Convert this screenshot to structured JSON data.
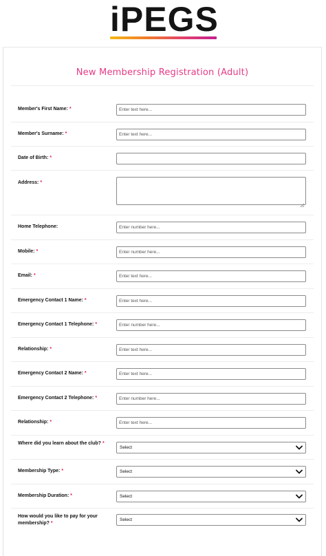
{
  "logo": {
    "text": "iPEGS"
  },
  "form": {
    "title": "New Membership Registration (Adult)",
    "required_mark": "*",
    "fields": [
      {
        "label": "Member's First Name:",
        "required": true,
        "type": "text",
        "placeholder": "Enter text here..."
      },
      {
        "label": "Member's Surname:",
        "required": true,
        "type": "text",
        "placeholder": "Enter text here..."
      },
      {
        "label": "Date of Birth:",
        "required": true,
        "type": "text",
        "placeholder": ""
      },
      {
        "label": "Address:",
        "required": true,
        "type": "textarea",
        "placeholder": ""
      },
      {
        "label": "Home Telephone:",
        "required": false,
        "type": "text",
        "placeholder": "Enter number here..."
      },
      {
        "label": "Mobile:",
        "required": true,
        "type": "text",
        "placeholder": "Enter number here..."
      },
      {
        "label": "Email:",
        "required": true,
        "type": "text",
        "placeholder": "Enter text here..."
      },
      {
        "label": "Emergency Contact 1 Name:",
        "required": true,
        "type": "text",
        "placeholder": "Enter text here..."
      },
      {
        "label": "Emergency Contact 1 Telephone:",
        "required": true,
        "type": "text",
        "placeholder": "Enter number here..."
      },
      {
        "label": "Relationship:",
        "required": true,
        "type": "text",
        "placeholder": "Enter text here..."
      },
      {
        "label": "Emergency Contact 2 Name:",
        "required": true,
        "type": "text",
        "placeholder": "Enter text here..."
      },
      {
        "label": "Emergency Contact 2 Telephone:",
        "required": true,
        "type": "text",
        "placeholder": "Enter number here..."
      },
      {
        "label": "Relationship:",
        "required": true,
        "type": "text",
        "placeholder": "Enter text here..."
      },
      {
        "label": "Where did you learn about the club?",
        "required": true,
        "type": "select",
        "value": "Select"
      },
      {
        "label": "Membership Type:",
        "required": true,
        "type": "select",
        "value": "Select"
      },
      {
        "label": "Membership Duration:",
        "required": true,
        "type": "select",
        "value": "Select"
      },
      {
        "label": "How would you like to pay for your membership?",
        "required": true,
        "type": "select",
        "value": "Select"
      }
    ]
  },
  "colors": {
    "title": "#e63a86",
    "required": "#e0204a",
    "logo_gradient": [
      "#f5b814",
      "#f07b2a",
      "#e23f6e",
      "#c4208e"
    ]
  },
  "icons": {
    "select_arrow": "chevron-down-icon",
    "textarea_grip": "resize-grip-icon"
  }
}
